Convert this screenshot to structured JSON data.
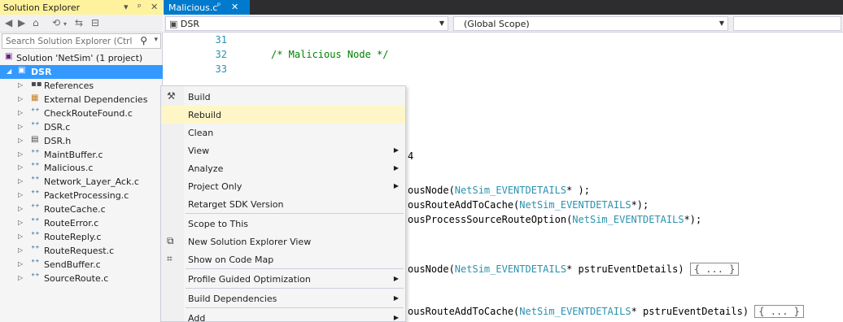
{
  "solution_explorer": {
    "title": "Solution Explorer",
    "title_glyphs": {
      "dropdown": "▾",
      "pin": "ᵖ",
      "close": "✕"
    },
    "toolbar_icons": [
      "back-icon",
      "forward-icon",
      "home-icon",
      "sync-icon",
      "switch-views-icon",
      "collapse-icon"
    ],
    "search_placeholder": "Search Solution Explorer (Ctrl",
    "solution_label": "Solution 'NetSim' (1 project)",
    "project_label": "DSR",
    "items": [
      {
        "label": "References",
        "icon": "references-icon"
      },
      {
        "label": "External Dependencies",
        "icon": "external-deps-icon"
      },
      {
        "label": "CheckRouteFound.c",
        "icon": "c-file-icon"
      },
      {
        "label": "DSR.c",
        "icon": "c-file-icon"
      },
      {
        "label": "DSR.h",
        "icon": "h-file-icon"
      },
      {
        "label": "MaintBuffer.c",
        "icon": "c-file-icon"
      },
      {
        "label": "Malicious.c",
        "icon": "c-file-icon"
      },
      {
        "label": "Network_Layer_Ack.c",
        "icon": "c-file-icon"
      },
      {
        "label": "PacketProcessing.c",
        "icon": "c-file-icon"
      },
      {
        "label": "RouteCache.c",
        "icon": "c-file-icon"
      },
      {
        "label": "RouteError.c",
        "icon": "c-file-icon"
      },
      {
        "label": "RouteReply.c",
        "icon": "c-file-icon"
      },
      {
        "label": "RouteRequest.c",
        "icon": "c-file-icon"
      },
      {
        "label": "SendBuffer.c",
        "icon": "c-file-icon"
      },
      {
        "label": "SourceRoute.c",
        "icon": "c-file-icon"
      }
    ]
  },
  "editor": {
    "tab": {
      "label": "Malicious.c",
      "pin_glyph": "ᵖ",
      "close_glyph": "✕"
    },
    "nav": {
      "project": "DSR",
      "scope": "(Global Scope)"
    },
    "line_numbers": [
      "31",
      "32",
      "33"
    ],
    "comment": "/* Malicious Node */",
    "fragments": {
      "l4": "4",
      "d1_pre": "ousNode(",
      "d1_type": "NetSim_EVENTDETAILS",
      "d1_post": "* );",
      "d2_pre": "ousRouteAddToCache(",
      "d2_type": "NetSim_EVENTDETAILS",
      "d2_post": "*);",
      "d3_pre": "ousProcessSourceRouteOption(",
      "d3_type": "NetSim_EVENTDETAILS",
      "d3_post": "*);",
      "f1_pre": "ousNode(",
      "f1_type": "NetSim_EVENTDETAILS",
      "f1_post": "* pstruEventDetails)",
      "f2_pre": "ousRouteAddToCache(",
      "f2_type": "NetSim_EVENTDETAILS",
      "f2_post": "* pstruEventDetails)",
      "collapsed": "{ ... }"
    }
  },
  "context_menu": {
    "items": [
      {
        "label": "Build",
        "icon": "build-icon",
        "submenu": false
      },
      {
        "label": "Rebuild",
        "submenu": false,
        "highlighted": true
      },
      {
        "label": "Clean",
        "submenu": false
      },
      {
        "label": "View",
        "submenu": true
      },
      {
        "label": "Analyze",
        "submenu": true
      },
      {
        "label": "Project Only",
        "submenu": true
      },
      {
        "label": "Retarget SDK Version",
        "submenu": false
      },
      {
        "label": "Scope to This",
        "submenu": false
      },
      {
        "label": "New Solution Explorer View",
        "icon": "new-view-icon",
        "submenu": false
      },
      {
        "label": "Show on Code Map",
        "icon": "code-map-icon",
        "submenu": false
      },
      {
        "label": "Profile Guided Optimization",
        "submenu": true
      },
      {
        "label": "Build Dependencies",
        "submenu": true
      },
      {
        "label": "Add",
        "submenu": true
      }
    ]
  },
  "colors": {
    "panel_title_active": "#fff29d",
    "selection": "#3399ff",
    "tab_active": "#007acc",
    "menu_highlight": "#fff6c8",
    "comment": "#008000",
    "type_name": "#2b91af"
  }
}
